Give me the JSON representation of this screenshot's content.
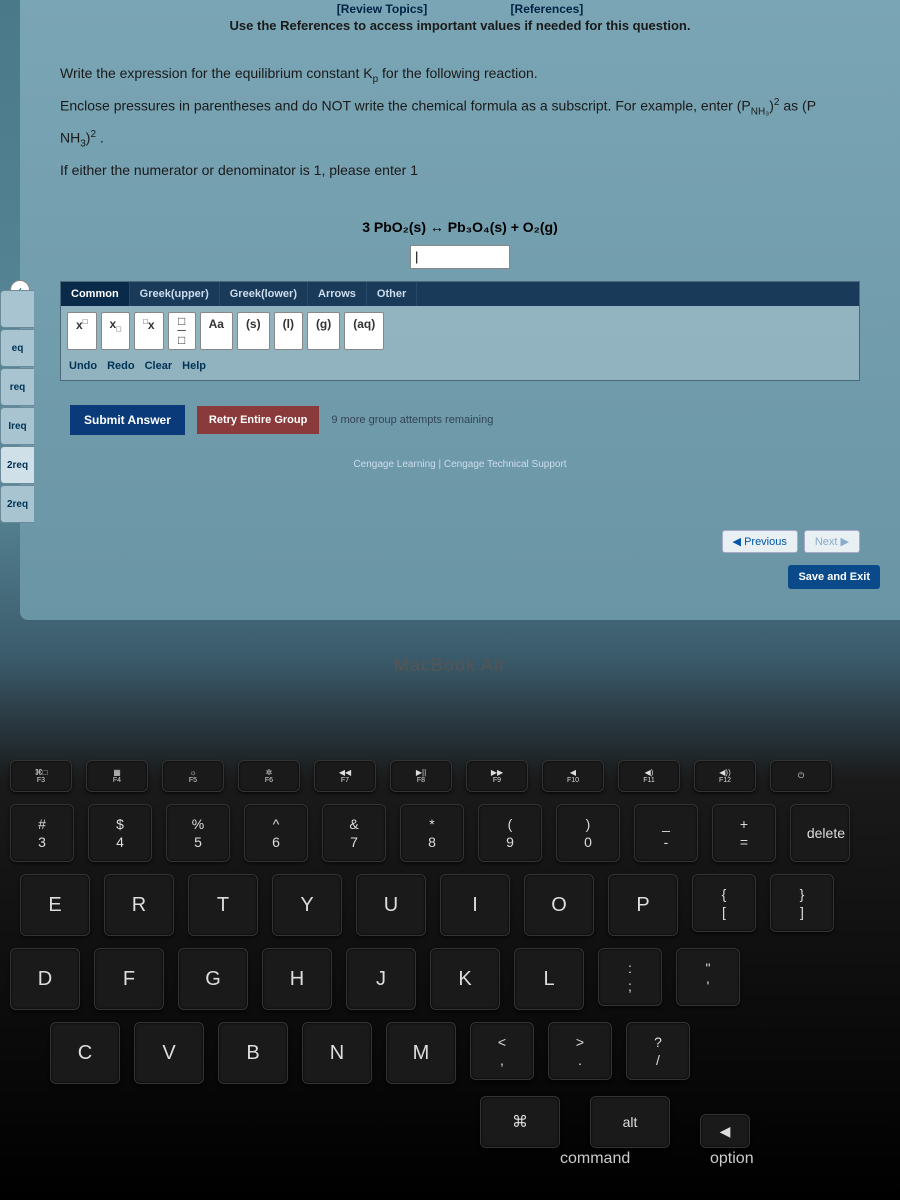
{
  "top": {
    "review": "[Review Topics]",
    "references": "[References]",
    "instruction": "Use the References to access important values if needed for this question."
  },
  "question": {
    "line1_a": "Write the expression for the equilibrium constant K",
    "line1_sub": "p",
    "line1_b": " for the following reaction.",
    "line2_a": "Enclose pressures in parentheses and do NOT write the chemical formula as a subscript. For example, enter (P",
    "line2_sub": "NH₃",
    "line2_b": ")",
    "line2_sup": "2",
    "line2_c": " as (P",
    "line3_a": "NH",
    "line3_sub": "3",
    "line3_b": ")",
    "line3_sup": "2",
    "line3_c": " .",
    "line4": "If either the numerator or denominator is 1, please enter 1"
  },
  "equation": {
    "text": "3 PbO₂(s)   ↔   Pb₃O₄(s) + O₂(g)"
  },
  "input_value": "|",
  "editor": {
    "tabs": [
      "Common",
      "Greek(upper)",
      "Greek(lower)",
      "Arrows",
      "Other"
    ],
    "buttons": {
      "sup": "x□",
      "sub": "x□",
      "presup": "□x",
      "frac": "□/□",
      "aa": "Aa",
      "s": "(s)",
      "l": "(l)",
      "g": "(g)",
      "aq": "(aq)"
    },
    "secondary": [
      "Undo",
      "Redo",
      "Clear",
      "Help"
    ]
  },
  "submit": {
    "submit_label": "Submit Answer",
    "retry_label": "Retry Entire Group",
    "attempts": "9 more group attempts remaining"
  },
  "nav": {
    "prev": "Previous",
    "next": "Next",
    "save_exit": "Save and Exit"
  },
  "footer": "Cengage Learning  |  Cengage Technical Support",
  "sidebar": {
    "items": [
      "",
      "eq",
      "req",
      "Ireq",
      "2req",
      "2req"
    ]
  },
  "laptop": "MacBook Air",
  "keys": {
    "fn_row": [
      {
        "main": "⌘□",
        "sub": "F3"
      },
      {
        "main": "▦",
        "sub": "F4"
      },
      {
        "main": "☼",
        "sub": "F5"
      },
      {
        "main": "✲",
        "sub": "F6"
      },
      {
        "main": "◀◀",
        "sub": "F7"
      },
      {
        "main": "▶||",
        "sub": "F8"
      },
      {
        "main": "▶▶",
        "sub": "F9"
      },
      {
        "main": "◀",
        "sub": "F10"
      },
      {
        "main": "◀)",
        "sub": "F11"
      },
      {
        "main": "◀))",
        "sub": "F12"
      },
      {
        "main": "⏻",
        "sub": ""
      }
    ],
    "num_row": [
      {
        "top": "#",
        "bot": "3"
      },
      {
        "top": "$",
        "bot": "4"
      },
      {
        "top": "%",
        "bot": "5"
      },
      {
        "top": "^",
        "bot": "6"
      },
      {
        "top": "&",
        "bot": "7"
      },
      {
        "top": "*",
        "bot": "8"
      },
      {
        "top": "(",
        "bot": "9"
      },
      {
        "top": ")",
        "bot": "0"
      },
      {
        "top": "_",
        "bot": "-"
      },
      {
        "top": "+",
        "bot": "="
      }
    ],
    "delete": "delete",
    "row3": [
      "E",
      "R",
      "T",
      "Y",
      "U",
      "I",
      "O",
      "P"
    ],
    "row3_brackets": [
      {
        "top": "{",
        "bot": "["
      },
      {
        "top": "}",
        "bot": "]"
      }
    ],
    "row4": [
      "D",
      "F",
      "G",
      "H",
      "J",
      "K",
      "L"
    ],
    "row4_punct": [
      {
        "top": ":",
        "bot": ";"
      },
      {
        "top": "\"",
        "bot": "'"
      }
    ],
    "row5": [
      "C",
      "V",
      "B",
      "N",
      "M"
    ],
    "row5_punct": [
      {
        "top": "<",
        "bot": ","
      },
      {
        "top": ">",
        "bot": "."
      },
      {
        "top": "?",
        "bot": "/"
      }
    ],
    "mods": {
      "cmd_sym": "⌘",
      "command": "command",
      "alt": "alt",
      "option": "option"
    },
    "arrow": "◀"
  }
}
